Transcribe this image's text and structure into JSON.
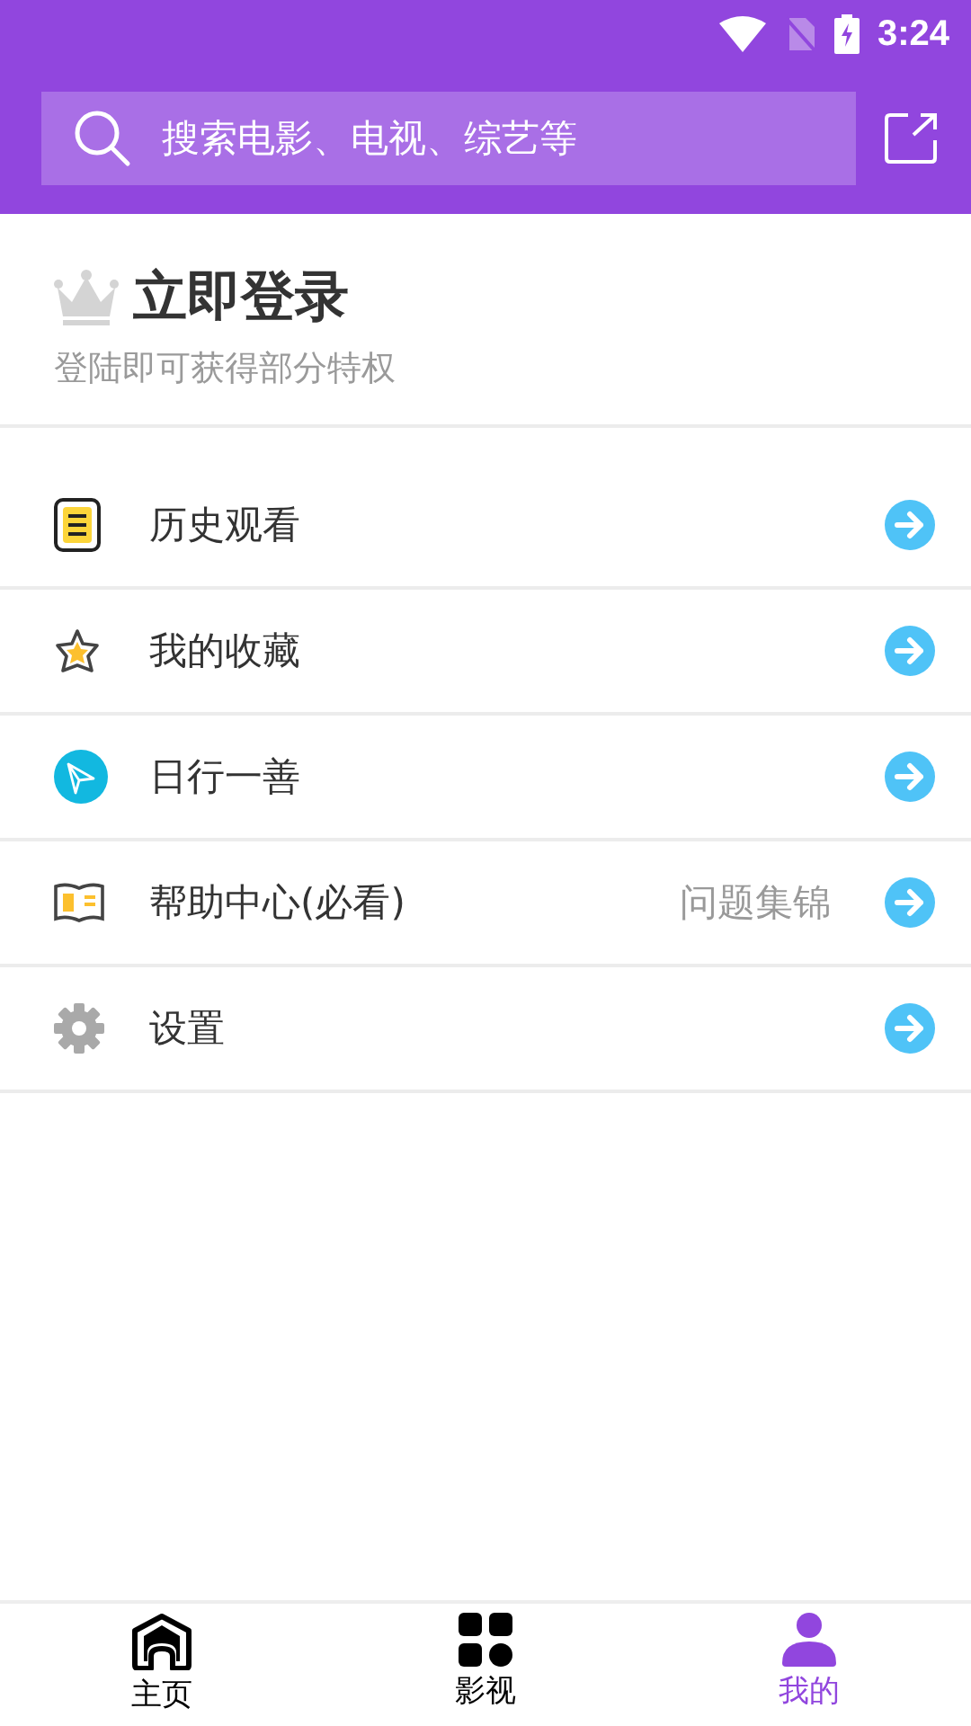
{
  "status_bar": {
    "time": "3:24"
  },
  "search": {
    "placeholder": "搜索电影、电视、综艺等"
  },
  "login": {
    "title": "立即登录",
    "subtitle": "登陆即可获得部分特权"
  },
  "menu": [
    {
      "kind": "history",
      "label": "历史观看"
    },
    {
      "kind": "favorite",
      "label": "我的收藏"
    },
    {
      "kind": "plane",
      "label": "日行一善"
    },
    {
      "kind": "book",
      "label": "帮助中心(必看)",
      "note": "问题集锦"
    },
    {
      "kind": "gear",
      "label": "设置"
    }
  ],
  "tabs": [
    {
      "kind": "home",
      "label": "主页",
      "selected": false
    },
    {
      "kind": "grid",
      "label": "影视",
      "selected": false
    },
    {
      "kind": "person",
      "label": "我的",
      "selected": true
    }
  ]
}
